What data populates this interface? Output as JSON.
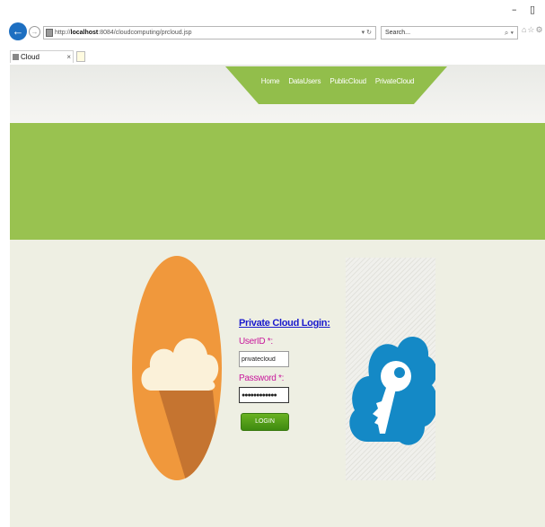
{
  "window": {
    "minimize_glyph": "–",
    "maximize_glyph": "▯"
  },
  "browser": {
    "back_glyph": "←",
    "forward_glyph": "→",
    "url_prefix": "http://",
    "url_host": "localhost",
    "url_path": ":8084/cloudcomputing/prcloud.jsp",
    "address_tools": "▾ ↻",
    "search_placeholder": "Search...",
    "search_tools": "⌕ ▾",
    "nav_icons": "⌂☆⚙",
    "tab_title": "Cloud",
    "tab_close": "×"
  },
  "nav": {
    "items": [
      {
        "label": "Home"
      },
      {
        "label": "DataUsers"
      },
      {
        "label": "PublicCloud"
      },
      {
        "label": "PrivateCloud"
      }
    ]
  },
  "login": {
    "title": "Private Cloud Login:",
    "userid_label": "UserID *:",
    "userid_value": "privatecloud",
    "password_label": "Password *:",
    "password_mask": "●●●●●●●●●●●●",
    "button_label": "LOGIN"
  },
  "colors": {
    "nav_green": "#92be4b",
    "banner_green": "#99c250",
    "page_bg": "#eeefe3",
    "orange": "#f0983c",
    "cloud_blue": "#1489c6",
    "title_blue": "#1a1acd",
    "label_magenta": "#c8189b",
    "button_green": "#4e9c16"
  },
  "icons": {
    "left_emblem": "cloud-icon",
    "right_emblem": "cloud-key-icon"
  }
}
